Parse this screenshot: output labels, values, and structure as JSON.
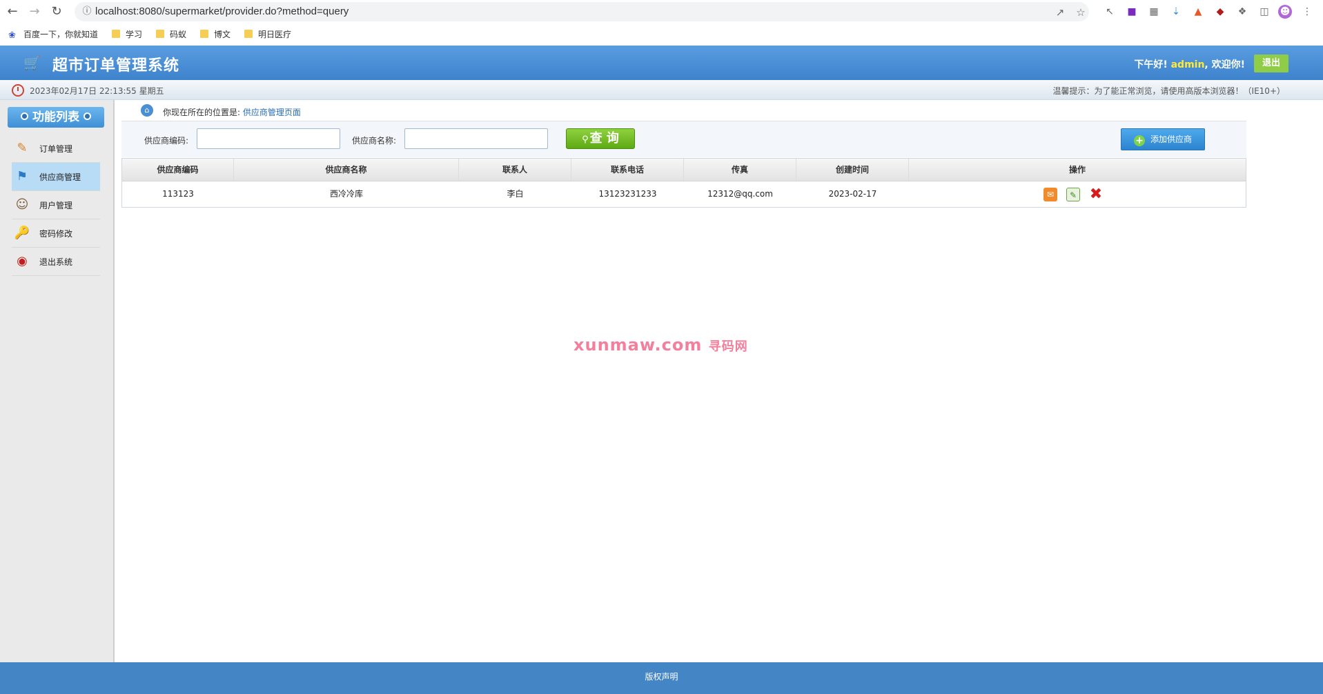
{
  "browser": {
    "url": "localhost:8080/supermarket/provider.do?method=query",
    "bookmarks": [
      {
        "label": "百度一下，你就知道"
      },
      {
        "label": "学习"
      },
      {
        "label": "码蚁"
      },
      {
        "label": "博文"
      },
      {
        "label": "明日医疗"
      }
    ]
  },
  "header": {
    "title": "超市订单管理系统",
    "greeting_prefix": "下午好!",
    "username": "admin",
    "greeting_suffix": ", 欢迎你!",
    "logout_label": "退出"
  },
  "info_bar": {
    "datetime": "2023年02月17日 22:13:55 星期五",
    "tip": "温馨提示：为了能正常浏览，请使用高版本浏览器！（IE10+）"
  },
  "sidebar": {
    "title": "功能列表",
    "items": [
      {
        "label": "订单管理",
        "icon": "order-icon",
        "active": false
      },
      {
        "label": "供应商管理",
        "icon": "provider-icon",
        "active": true
      },
      {
        "label": "用户管理",
        "icon": "users-icon",
        "active": false
      },
      {
        "label": "密码修改",
        "icon": "password-icon",
        "active": false
      },
      {
        "label": "退出系统",
        "icon": "exit-icon",
        "active": false
      }
    ]
  },
  "breadcrumb": {
    "prefix": "你现在所在的位置是:",
    "current": "供应商管理页面"
  },
  "search": {
    "code_label": "供应商编码:",
    "code_value": "",
    "name_label": "供应商名称:",
    "name_value": "",
    "query_label": "查 询",
    "add_label": "添加供应商"
  },
  "table": {
    "headers": [
      "供应商编码",
      "供应商名称",
      "联系人",
      "联系电话",
      "传真",
      "创建时间",
      "操作"
    ],
    "rows": [
      {
        "code": "113123",
        "name": "西冷冷库",
        "contact": "李白",
        "phone": "13123231233",
        "fax": "12312@qq.com",
        "created": "2023-02-17"
      }
    ]
  },
  "watermark": {
    "text": "xunmaw.com",
    "sub": "寻码网"
  },
  "footer": {
    "label": "版权声明"
  },
  "colors": {
    "header_blue": "#3d83cc",
    "query_green": "#5ea913",
    "add_blue": "#2b84cf",
    "footer_blue": "#4385c5"
  }
}
